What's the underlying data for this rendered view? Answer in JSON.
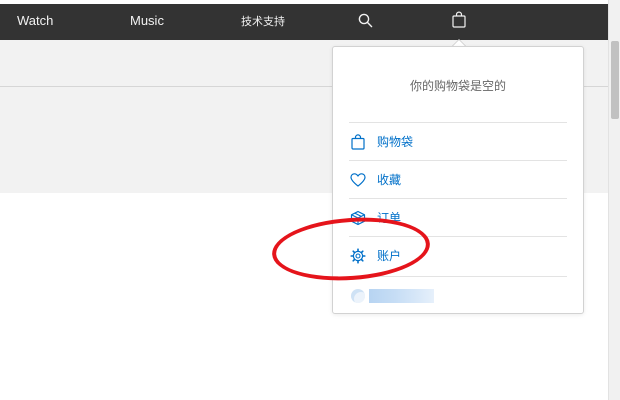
{
  "nav": {
    "items": [
      {
        "key": "watch",
        "label": "Watch"
      },
      {
        "key": "music",
        "label": "Music"
      },
      {
        "key": "support",
        "label": "技术支持"
      }
    ],
    "icons": {
      "search": "search-icon",
      "bag": "shopping-bag-icon"
    }
  },
  "bag_dropdown": {
    "empty_message": "你的购物袋是空的",
    "items": [
      {
        "label": "购物袋",
        "icon": "shopping-bag-icon"
      },
      {
        "label": "收藏",
        "icon": "heart-icon"
      },
      {
        "label": "订单",
        "icon": "package-icon"
      },
      {
        "label": "账户",
        "icon": "gear-icon"
      }
    ],
    "account_name_blurred": true
  },
  "colors": {
    "nav_bg": "#333333",
    "link_blue": "#0070c9",
    "annotation_red": "#e5141b",
    "band_gray": "#f2f2f2"
  }
}
